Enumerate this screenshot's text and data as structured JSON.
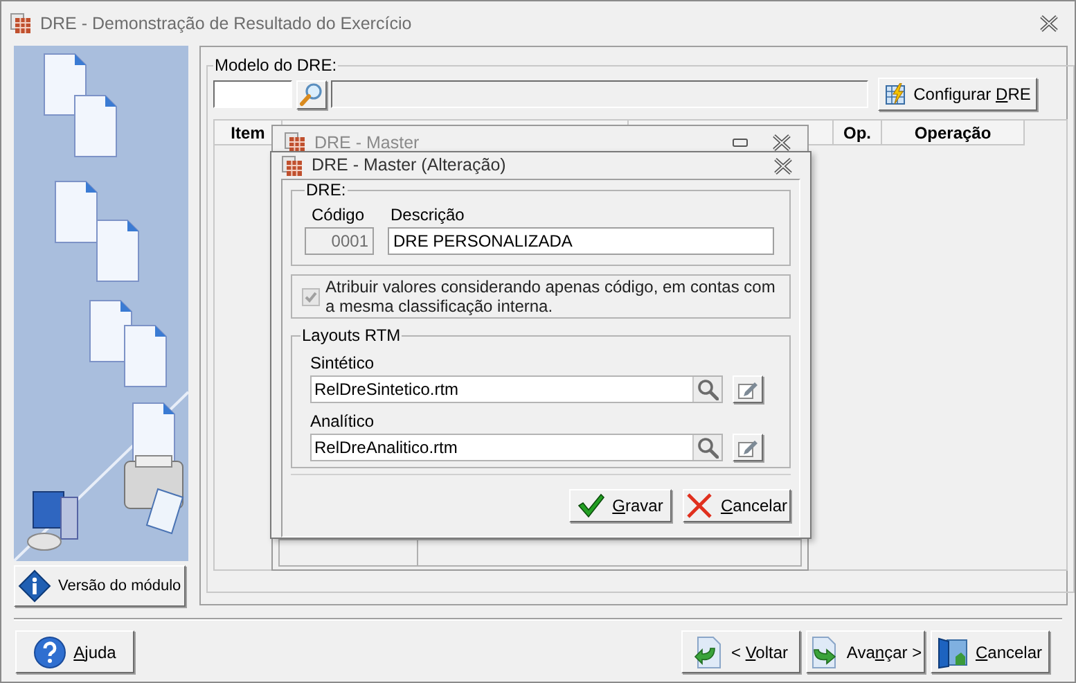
{
  "window": {
    "title": "DRE - Demonstração de Resultado do Exercício"
  },
  "sidebar": {
    "button": {
      "before": "Versão do módulo"
    }
  },
  "model_group": {
    "legend": "Modelo do DRE:",
    "configure_button": {
      "before": "Configurar ",
      "key": "D",
      "after": "RE"
    }
  },
  "table": {
    "columns": [
      {
        "kind": "text",
        "label": "Item"
      },
      {
        "kind": "blank"
      },
      {
        "kind": "blank"
      },
      {
        "kind": "text",
        "label": "Op."
      },
      {
        "kind": "text",
        "label": "Operação"
      }
    ]
  },
  "back_window": {
    "title": "DRE - Master"
  },
  "dialog": {
    "title": "DRE - Master (Alteração)",
    "dre_group": {
      "legend": "DRE:",
      "code_label": "Código",
      "code_value": "0001",
      "code_disabled": true,
      "description_label": "Descrição",
      "description_value": "DRE PERSONALIZADA"
    },
    "option": {
      "label": "Atribuir valores considerando apenas código, em contas com a mesma classificação interna.",
      "checked": true,
      "disabled": true
    },
    "layouts_group": {
      "legend": "Layouts RTM",
      "fields": [
        {
          "label": "Sintético",
          "value": "RelDreSintetico.rtm"
        },
        {
          "label": "Analítico",
          "value": "RelDreAnalitico.rtm"
        }
      ]
    },
    "buttons": [
      {
        "kind": "save",
        "key": "G",
        "after": "ravar"
      },
      {
        "kind": "cancel",
        "key": "C",
        "after": "ancelar"
      }
    ]
  },
  "footer_buttons": [
    {
      "kind": "help",
      "key": "A",
      "after": "juda"
    },
    {
      "kind": "back",
      "before": "< ",
      "key": "V",
      "after": "oltar"
    },
    {
      "kind": "next",
      "before": "Ava",
      "key": "n",
      "after": "çar >"
    },
    {
      "kind": "cancel",
      "key": "C",
      "after": "ancelar"
    }
  ]
}
